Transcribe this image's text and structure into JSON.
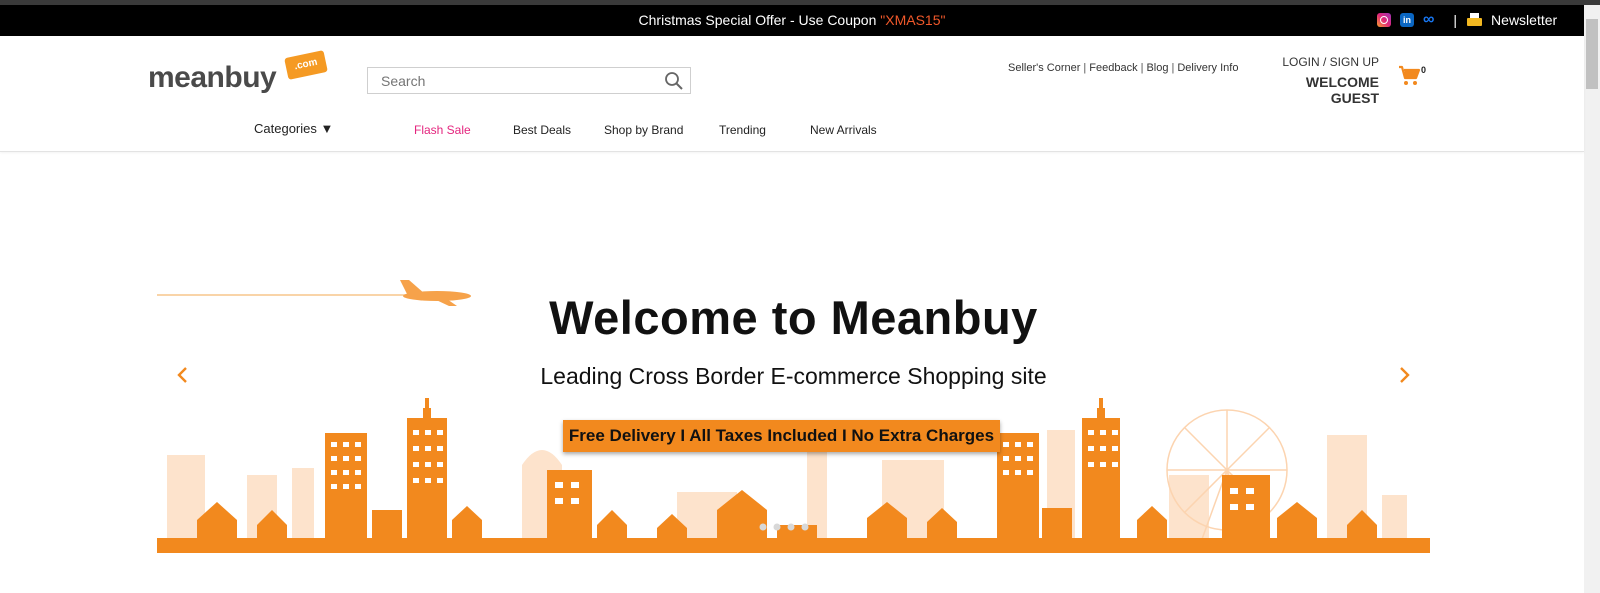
{
  "promo": {
    "text": "Christmas Special Offer - Use Coupon ",
    "coupon": "\"XMAS15\"",
    "divider": "|",
    "newsletter": "Newsletter"
  },
  "header": {
    "logo_word": "meanbuy",
    "logo_tag": ".com",
    "search_placeholder": "Search",
    "links": [
      "Seller's Corner",
      "Feedback",
      "Blog",
      "Delivery Info"
    ],
    "link_sep": "|",
    "login": "LOGIN / SIGN UP",
    "welcome": "WELCOME GUEST",
    "cart_count": "0"
  },
  "nav": {
    "categories": "Categories ▼",
    "items": [
      "Flash Sale",
      "Best Deals",
      "Shop by Brand",
      "Trending",
      "New Arrivals"
    ]
  },
  "hero": {
    "title": "Welcome to Meanbuy",
    "subtitle": "Leading Cross Border E-commerce Shopping site",
    "badge": "Free Delivery I All Taxes Included I No Extra Charges"
  },
  "colors": {
    "accent": "#f2891e",
    "coupon": "#f0582a",
    "flash": "#e4257e",
    "skyline_light": "#fde3cc"
  },
  "icons": [
    "instagram-icon",
    "linkedin-icon",
    "meta-icon",
    "printer-icon",
    "search-icon",
    "cart-icon",
    "chevron-left-icon",
    "chevron-right-icon",
    "airplane-icon"
  ]
}
